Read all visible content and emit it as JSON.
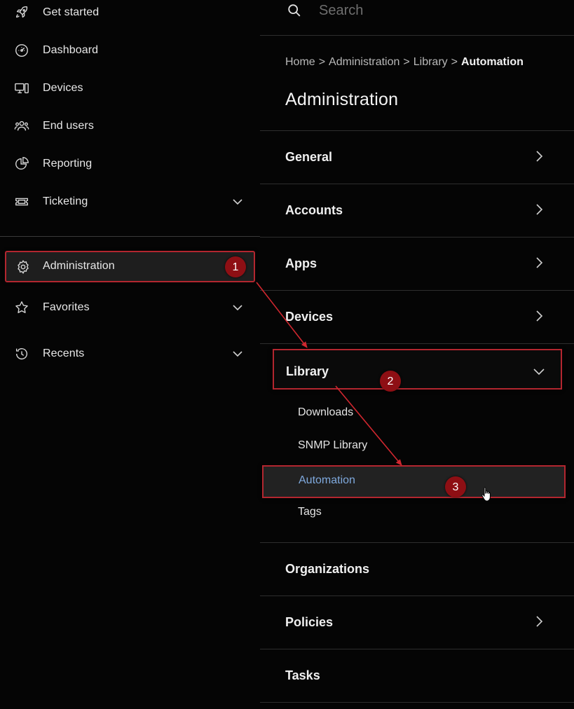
{
  "sidebar": {
    "items": [
      {
        "label": "Get started",
        "icon": "rocket-icon"
      },
      {
        "label": "Dashboard",
        "icon": "gauge-icon"
      },
      {
        "label": "Devices",
        "icon": "devices-icon"
      },
      {
        "label": "End users",
        "icon": "users-icon"
      },
      {
        "label": "Reporting",
        "icon": "pie-chart-icon"
      },
      {
        "label": "Ticketing",
        "icon": "ticket-icon"
      },
      {
        "label": "Administration",
        "icon": "gear-icon"
      },
      {
        "label": "Favorites",
        "icon": "star-icon"
      },
      {
        "label": "Recents",
        "icon": "history-icon"
      }
    ]
  },
  "search": {
    "placeholder": "Search"
  },
  "breadcrumb": {
    "home": "Home",
    "administration": "Administration",
    "library": "Library",
    "current": "Automation",
    "separator": ">"
  },
  "page": {
    "title": "Administration"
  },
  "sections": {
    "general": "General",
    "accounts": "Accounts",
    "apps": "Apps",
    "devices": "Devices",
    "library": "Library",
    "organizations": "Organizations",
    "policies": "Policies",
    "tasks": "Tasks"
  },
  "library_items": {
    "downloads": "Downloads",
    "snmp": "SNMP Library",
    "automation": "Automation",
    "tags": "Tags"
  },
  "annotations": {
    "step1": "1",
    "step2": "2",
    "step3": "3"
  },
  "colors": {
    "background": "#050505",
    "highlight_border": "#b3262f",
    "badge": "#8e0f14",
    "active_link": "#7fa9dd",
    "arrow": "#d0272f"
  }
}
